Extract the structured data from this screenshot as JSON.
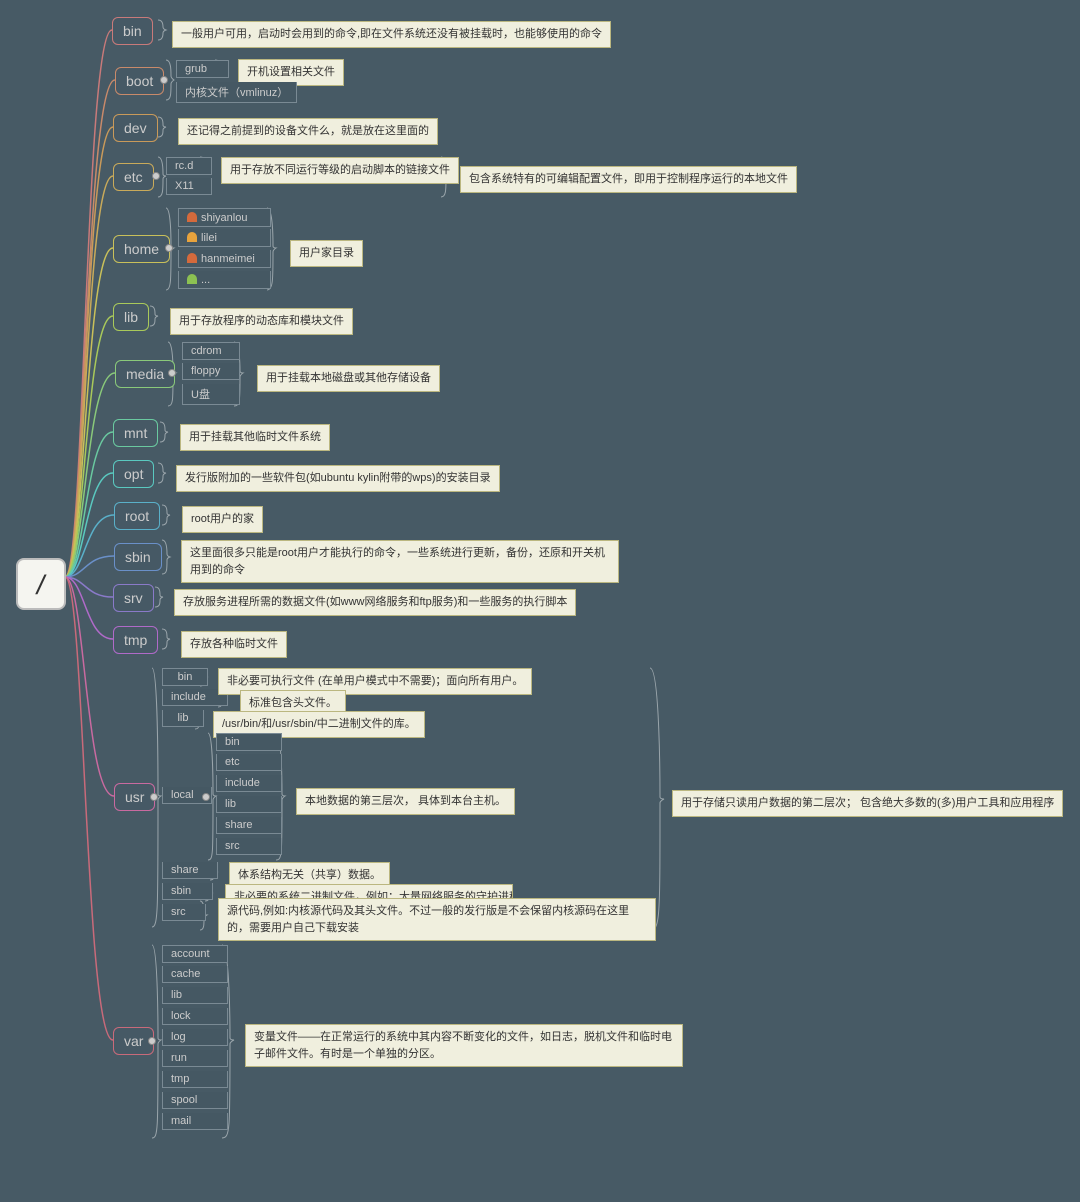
{
  "root": "/",
  "dirs": {
    "bin": {
      "label": "bin",
      "desc": "一般用户可用，启动时会用到的命令,即在文件系统还没有被挂载时，也能够使用的命令"
    },
    "boot": {
      "label": "boot",
      "sub": {
        "grub": "grub",
        "kernel": "内核文件（vmlinuz）"
      },
      "desc_grub": "开机设置相关文件"
    },
    "dev": {
      "label": "dev",
      "desc": "还记得之前提到的设备文件么，就是放在这里面的"
    },
    "etc": {
      "label": "etc",
      "sub": {
        "rcd": "rc.d",
        "x11": "X11"
      },
      "desc_rcd": "用于存放不同运行等级的启动脚本的链接文件",
      "desc": "包含系统特有的可编辑配置文件，即用于控制程序运行的本地文件"
    },
    "home": {
      "label": "home",
      "users": {
        "u1": "shiyanlou",
        "u2": "lilei",
        "u3": "hanmeimei",
        "u4": "..."
      },
      "desc": "用户家目录"
    },
    "lib": {
      "label": "lib",
      "desc": "用于存放程序的动态库和模块文件"
    },
    "media": {
      "label": "media",
      "sub": {
        "cdrom": "cdrom",
        "floppy": "floppy",
        "udisk": "U盘"
      },
      "desc": "用于挂载本地磁盘或其他存储设备"
    },
    "mnt": {
      "label": "mnt",
      "desc": "用于挂载其他临时文件系统"
    },
    "opt": {
      "label": "opt",
      "desc": "发行版附加的一些软件包(如ubuntu kylin附带的wps)的安装目录"
    },
    "root": {
      "label": "root",
      "desc": "root用户的家"
    },
    "sbin": {
      "label": "sbin",
      "desc": "这里面很多只能是root用户才能执行的命令，一些系统进行更新，备份，还原和开关机用到的命令"
    },
    "srv": {
      "label": "srv",
      "desc": "存放服务进程所需的数据文件(如www网络服务和ftp服务)和一些服务的执行脚本"
    },
    "tmp": {
      "label": "tmp",
      "desc": "存放各种临时文件"
    },
    "usr": {
      "label": "usr",
      "sub": {
        "bin": "bin",
        "include": "include",
        "lib": "lib",
        "local": "local",
        "share": "share",
        "sbin": "sbin",
        "src": "src"
      },
      "local_sub": {
        "bin": "bin",
        "etc": "etc",
        "include": "include",
        "lib": "lib",
        "share": "share",
        "src": "src"
      },
      "desc_bin": "非必要可执行文件 (在单用户模式中不需要)；面向所有用户。",
      "desc_include": "标准包含头文件。",
      "desc_lib": "/usr/bin/和/usr/sbin/中二进制文件的库。",
      "desc_local": "本地数据的第三层次， 具体到本台主机。",
      "desc_share": "体系结构无关（共享）数据。",
      "desc_sbin": "非必要的系统二进制文件，例如：大量网络服务的守护进程。",
      "desc_src": "源代码,例如:内核源代码及其头文件。不过一般的发行版是不会保留内核源码在这里的，需要用户自己下载安装",
      "desc": "用于存储只读用户数据的第二层次； 包含绝大多数的(多)用户工具和应用程序"
    },
    "var": {
      "label": "var",
      "sub": {
        "account": "account",
        "cache": "cache",
        "lib": "lib",
        "lock": "lock",
        "log": "log",
        "run": "run",
        "tmp": "tmp",
        "spool": "spool",
        "mail": "mail"
      },
      "desc": "变量文件——在正常运行的系统中其内容不断变化的文件，如日志，脱机文件和临时电子邮件文件。有时是一个单独的分区。"
    }
  },
  "colors": {
    "bin": "#c97a7a",
    "boot": "#c98a6a",
    "dev": "#c99a5a",
    "etc": "#c9aa5a",
    "home": "#c9c05a",
    "lib": "#a9c95a",
    "media": "#8ac97a",
    "mnt": "#6ac9a0",
    "opt": "#5ac9c0",
    "root": "#5ab0c9",
    "sbin": "#6a90c9",
    "srv": "#8a7ac9",
    "tmp": "#b06ac9",
    "usr": "#c96aa0",
    "var": "#c96a7a"
  }
}
